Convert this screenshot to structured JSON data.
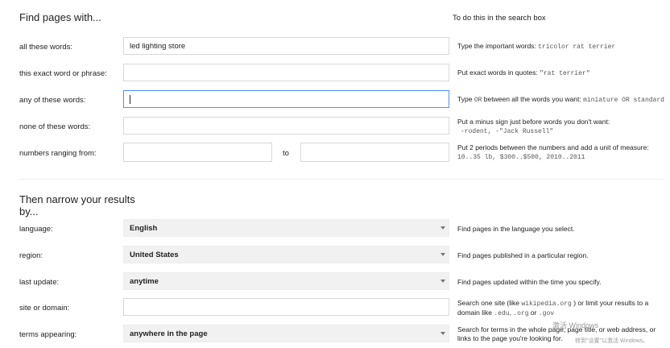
{
  "header": {
    "left_title": "Find pages with...",
    "right_title": "To do this in the search box"
  },
  "rows": {
    "all_words": {
      "label": "all these words:",
      "value": "led lighting store",
      "hint_text": "Type the important words:",
      "hint_example": "tricolor rat terrier"
    },
    "exact_phrase": {
      "label": "this exact word or phrase:",
      "value": "",
      "hint_text": "Put exact words in quotes:",
      "hint_example": "\"rat terrier\""
    },
    "any_words": {
      "label": "any of these words:",
      "value": "",
      "hint_pre": "Type",
      "hint_or": "OR",
      "hint_mid": "between all the words you want:",
      "hint_example": "miniature OR standard"
    },
    "none_words": {
      "label": "none of these words:",
      "value": "",
      "hint_text": "Put a minus sign just before words you don't want:",
      "hint_example": "-rodent, -\"Jack Russell\""
    },
    "numbers": {
      "label": "numbers ranging from:",
      "from_value": "",
      "to_label": "to",
      "to_value": "",
      "hint_text": "Put 2 periods between the numbers and add a unit of measure:",
      "hint_example": "10..35 lb, $300..$500, 2010..2011"
    }
  },
  "narrow": {
    "title": "Then narrow your results by...",
    "language": {
      "label": "language:",
      "selected": "English",
      "hint": "Find pages in the language you select."
    },
    "region": {
      "label": "region:",
      "selected": "United States",
      "hint": "Find pages published in a particular region."
    },
    "last_update": {
      "label": "last update:",
      "selected": "anytime",
      "hint": "Find pages updated within the time you specify."
    },
    "site_domain": {
      "label": "site or domain:",
      "value": "",
      "hint_pre": "Search one site (like",
      "hint_ex1": "wikipedia.org",
      "hint_mid": ") or limit your results to a domain like",
      "hint_ex2": ".edu",
      "hint_comma": ",",
      "hint_ex3": ".org",
      "hint_or": "or",
      "hint_ex4": ".gov"
    },
    "terms_appearing": {
      "label": "terms appearing:",
      "selected": "anywhere in the page",
      "hint": "Search for terms in the whole page, page title, or web address, or links to the page you're looking for."
    }
  },
  "watermark": {
    "line1": "激活 Windows",
    "line2": "转到\"设置\"以激活 Windows。"
  }
}
